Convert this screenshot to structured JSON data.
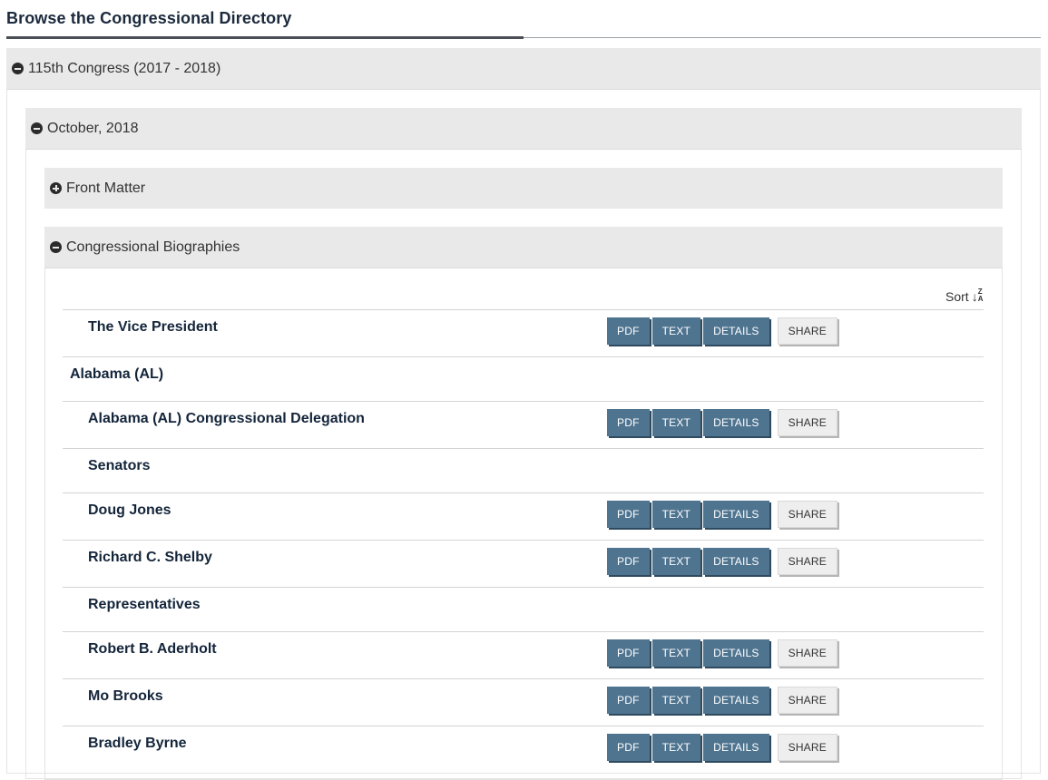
{
  "page": {
    "title": "Browse the Congressional Directory"
  },
  "accordion": {
    "congress": {
      "label": "115th Congress (2017 - 2018)",
      "state": "expanded"
    },
    "month": {
      "label": "October, 2018",
      "state": "expanded"
    },
    "front_matter": {
      "label": "Front Matter",
      "state": "collapsed"
    },
    "biographies": {
      "label": "Congressional Biographies",
      "state": "expanded"
    }
  },
  "sort": {
    "label": "Sort",
    "icon": "sort-z-a-icon"
  },
  "buttons": {
    "pdf": "PDF",
    "text": "TEXT",
    "details": "DETAILS",
    "share": "SHARE"
  },
  "rows": [
    {
      "label": "The Vice President",
      "level": 2,
      "has_buttons": true
    },
    {
      "label": "Alabama (AL)",
      "level": 1,
      "has_buttons": false
    },
    {
      "label": "Alabama (AL) Congressional Delegation",
      "level": 2,
      "has_buttons": true
    },
    {
      "label": "Senators",
      "level": 2,
      "has_buttons": false
    },
    {
      "label": "Doug Jones",
      "level": 2,
      "has_buttons": true
    },
    {
      "label": "Richard C. Shelby",
      "level": 2,
      "has_buttons": true
    },
    {
      "label": "Representatives",
      "level": 2,
      "has_buttons": false
    },
    {
      "label": "Robert B. Aderholt",
      "level": 2,
      "has_buttons": true
    },
    {
      "label": "Mo Brooks",
      "level": 2,
      "has_buttons": true
    },
    {
      "label": "Bradley Byrne",
      "level": 2,
      "has_buttons": true
    }
  ],
  "colors": {
    "button_primary": "#4f7490",
    "button_share": "#eeeeee",
    "header_bg": "#e9e9e9",
    "label_text": "#14253a"
  }
}
